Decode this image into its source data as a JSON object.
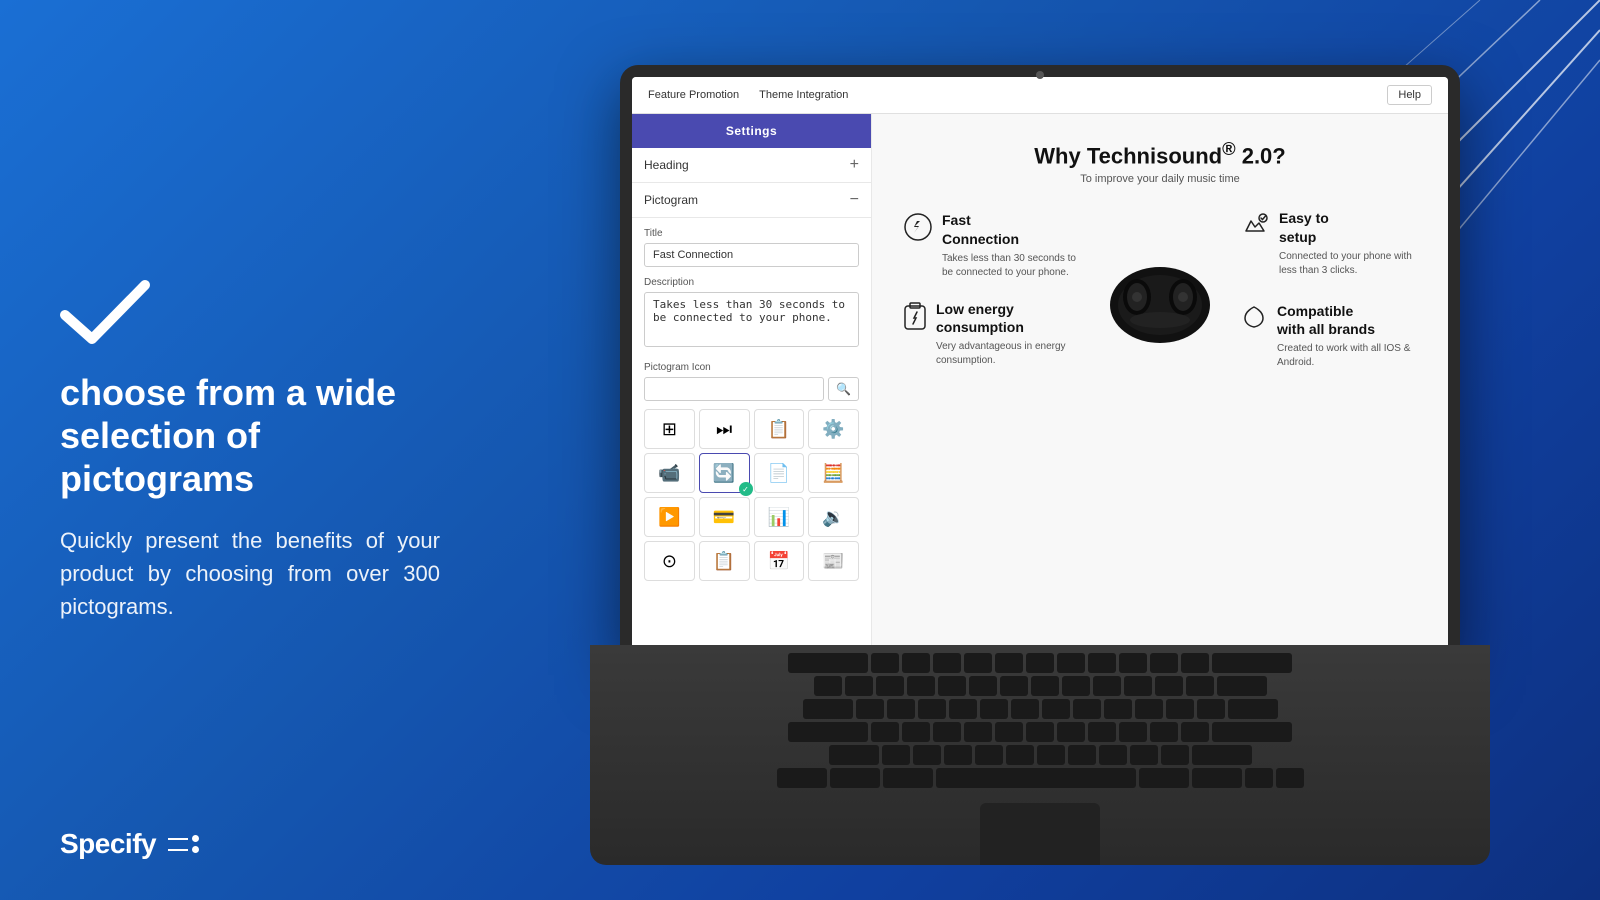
{
  "background": {
    "gradient_start": "#1a6fd4",
    "gradient_end": "#0d3080"
  },
  "left_panel": {
    "main_heading": "choose from a wide selection of pictograms",
    "sub_text": "Quickly present the benefits of your product by choosing from over 300 pictograms.",
    "logo": "Specify"
  },
  "app": {
    "nav": {
      "tabs": [
        "Feature Promotion",
        "Theme Integration"
      ],
      "help_button": "Help"
    },
    "sidebar": {
      "settings_label": "Settings",
      "heading_section": "Heading",
      "heading_expand": "+",
      "pictogram_section": "Pictogram",
      "pictogram_collapse": "−",
      "title_label": "Title",
      "title_value": "Fast Connection",
      "description_label": "Description",
      "description_value": "Takes less than 30 seconds to be connected to your phone.",
      "pictogram_icon_label": "Pictogram Icon",
      "search_placeholder": "",
      "icons": [
        "⊞",
        "⏭",
        "📋",
        "⚙",
        "📹",
        "🔄",
        "📄",
        "🧮",
        "▶",
        "💳",
        "📊",
        "🔉",
        "⊚",
        "📋",
        "📅",
        "📰"
      ]
    },
    "content": {
      "title": "Why Technisound® 2.0?",
      "subtitle": "To improve your daily music time",
      "features": [
        {
          "icon": "⚡",
          "title": "Fast Connection",
          "description": "Takes less than 30 seconds to be connected to your phone."
        },
        {
          "icon": "👍",
          "title": "Easy to setup",
          "description": "Connected to your phone with less than 3 clicks."
        },
        {
          "icon": "🔋",
          "title": "Low energy consumption",
          "description": "Very advantageous in energy consumption."
        },
        {
          "icon": "♡",
          "title": "Compatible with all brands",
          "description": "Created to work with all IOS & Android."
        }
      ]
    }
  }
}
